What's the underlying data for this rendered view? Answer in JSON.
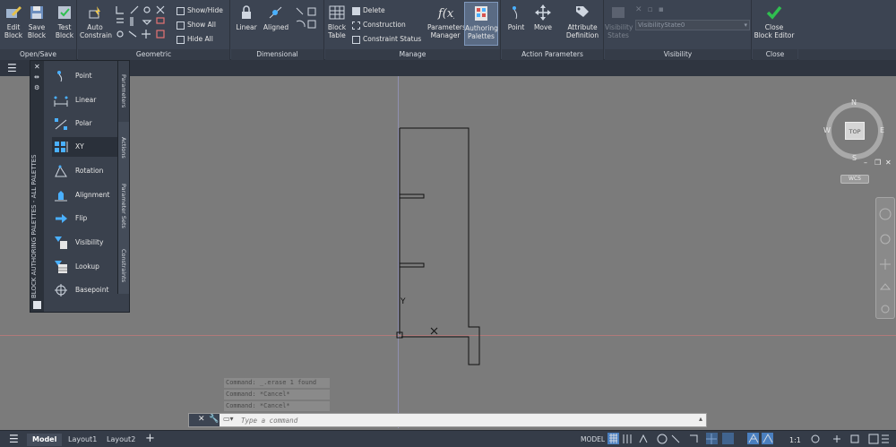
{
  "ribbon": {
    "open_save": {
      "title": "Open/Save",
      "edit_block": "Edit\nBlock",
      "save_block": "Save\nBlock",
      "test_block": "Test\nBlock"
    },
    "geometric": {
      "title": "Geometric",
      "auto_constrain": "Auto\nConstrain",
      "show_hide": "Show/Hide",
      "show_all": "Show All",
      "hide_all": "Hide All"
    },
    "dimensional": {
      "title": "Dimensional",
      "linear": "Linear",
      "aligned": "Aligned"
    },
    "manage": {
      "title": "Manage",
      "block_table": "Block\nTable",
      "delete": "Delete",
      "construction": "Construction",
      "constraint_status": "Constraint Status",
      "parameters_manager": "Parameters\nManager",
      "authoring_palettes": "Authoring\nPalettes"
    },
    "action_parameters": {
      "title": "Action Parameters",
      "point": "Point",
      "move": "Move",
      "attribute_definition": "Attribute\nDefinition"
    },
    "visibility": {
      "title": "Visibility",
      "visibility_states": "Visibility\nStates",
      "state_value": "VisibilityState0"
    },
    "close": {
      "title": "Close",
      "close_block_editor": "Close\nBlock Editor"
    }
  },
  "palette": {
    "vertical_title": "BLOCK AUTHORING PALETTES - ALL PALETTES",
    "tabs": [
      "Parameters",
      "Actions",
      "Parameter Sets",
      "Constraints"
    ],
    "items": [
      "Point",
      "Linear",
      "Polar",
      "XY",
      "Rotation",
      "Alignment",
      "Flip",
      "Visibility",
      "Lookup",
      "Basepoint"
    ],
    "selected": "XY"
  },
  "viewcube": {
    "north": "N",
    "south": "S",
    "east": "E",
    "west": "W",
    "face": "TOP",
    "wcs": "WCS"
  },
  "command": {
    "history": [
      "Command: _.erase 1 found",
      "Command: *Cancel*",
      "Command: *Cancel*"
    ],
    "placeholder": "Type a command"
  },
  "status": {
    "tabs": [
      "Model",
      "Layout1",
      "Layout2"
    ],
    "active_tab": "Model",
    "model_label": "MODEL",
    "scale": "1:1"
  },
  "colors": {
    "ribbon_bg": "#3c4452",
    "canvas_bg": "#7b7b7b",
    "accent": "#4ab0ff",
    "close_green": "#2fbf4f"
  }
}
